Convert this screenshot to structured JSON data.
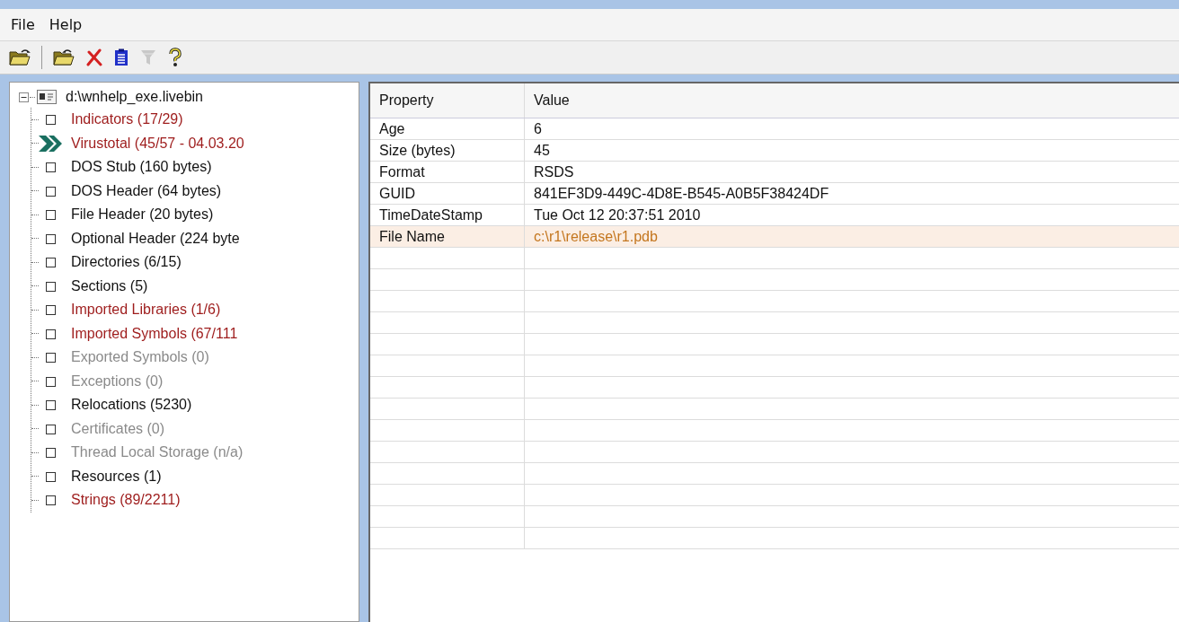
{
  "menu": [
    "File",
    "Help"
  ],
  "toolbar": [
    {
      "kind": "open",
      "disabled": false
    },
    {
      "kind": "reopen",
      "disabled": false
    },
    {
      "kind": "close",
      "disabled": false
    },
    {
      "kind": "report",
      "disabled": false
    },
    {
      "kind": "filter",
      "disabled": true
    },
    {
      "kind": "help",
      "disabled": false
    }
  ],
  "tree": {
    "label": "d:\\wnhelp_exe.livebin",
    "expanded": true,
    "children": [
      {
        "label": "Indicators (17/29)",
        "alert": true,
        "disabled": false,
        "kind": "box"
      },
      {
        "label": "Virustotal (45/57 - 04.03.20",
        "alert": true,
        "disabled": false,
        "kind": "flag"
      },
      {
        "label": "DOS Stub (160 bytes)",
        "alert": false,
        "disabled": false,
        "kind": "box"
      },
      {
        "label": "DOS Header (64 bytes)",
        "alert": false,
        "disabled": false,
        "kind": "box"
      },
      {
        "label": "File Header (20 bytes)",
        "alert": false,
        "disabled": false,
        "kind": "box"
      },
      {
        "label": "Optional Header (224 byte",
        "alert": false,
        "disabled": false,
        "kind": "box"
      },
      {
        "label": "Directories (6/15)",
        "alert": false,
        "disabled": false,
        "kind": "box"
      },
      {
        "label": "Sections (5)",
        "alert": false,
        "disabled": false,
        "kind": "box"
      },
      {
        "label": "Imported Libraries (1/6)",
        "alert": true,
        "disabled": false,
        "kind": "box"
      },
      {
        "label": "Imported Symbols (67/111",
        "alert": true,
        "disabled": false,
        "kind": "box"
      },
      {
        "label": "Exported Symbols (0)",
        "alert": false,
        "disabled": true,
        "kind": "box"
      },
      {
        "label": "Exceptions (0)",
        "alert": false,
        "disabled": true,
        "kind": "box"
      },
      {
        "label": "Relocations (5230)",
        "alert": false,
        "disabled": false,
        "kind": "box"
      },
      {
        "label": "Certificates (0)",
        "alert": false,
        "disabled": true,
        "kind": "box"
      },
      {
        "label": "Thread Local Storage (n/a)",
        "alert": false,
        "disabled": true,
        "kind": "box"
      },
      {
        "label": "Resources (1)",
        "alert": false,
        "disabled": false,
        "kind": "box"
      },
      {
        "label": "Strings (89/2211)",
        "alert": true,
        "disabled": false,
        "kind": "box"
      }
    ]
  },
  "table": {
    "columns": [
      "Property",
      "Value"
    ],
    "rows": [
      {
        "property": "Age",
        "value": "6",
        "highlighted": false
      },
      {
        "property": "Size (bytes)",
        "value": "45",
        "highlighted": false
      },
      {
        "property": "Format",
        "value": "RSDS",
        "highlighted": false
      },
      {
        "property": "GUID",
        "value": "841EF3D9-449C-4D8E-B545-A0B5F38424DF",
        "highlighted": false
      },
      {
        "property": "TimeDateStamp",
        "value": "Tue Oct 12 20:37:51 2010",
        "highlighted": false
      },
      {
        "property": "File Name",
        "value": "c:\\r1\\release\\r1.pdb",
        "highlighted": true
      }
    ]
  }
}
